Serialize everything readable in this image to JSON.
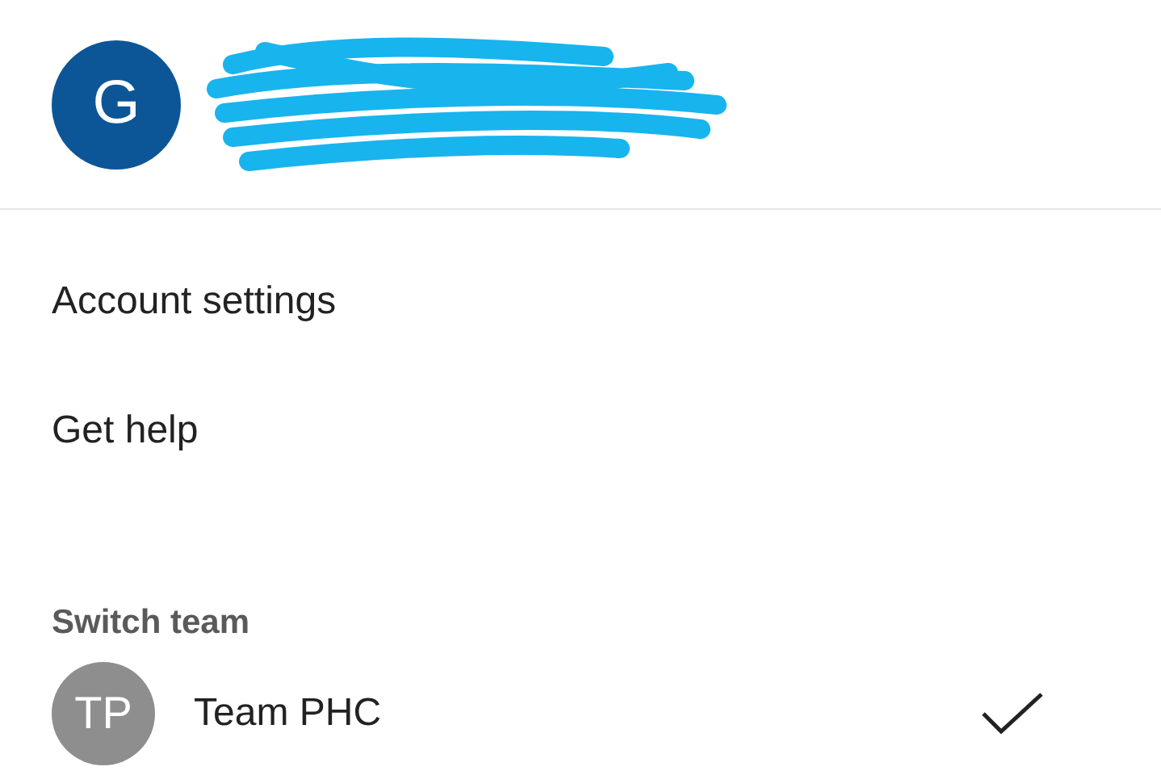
{
  "account": {
    "avatar_initial": "G"
  },
  "menu_items": [
    "Account settings",
    "Get help"
  ],
  "switch_team": {
    "title": "Switch team",
    "teams": [
      {
        "initials": "TP",
        "name": "Team PHC",
        "selected": true
      }
    ]
  }
}
